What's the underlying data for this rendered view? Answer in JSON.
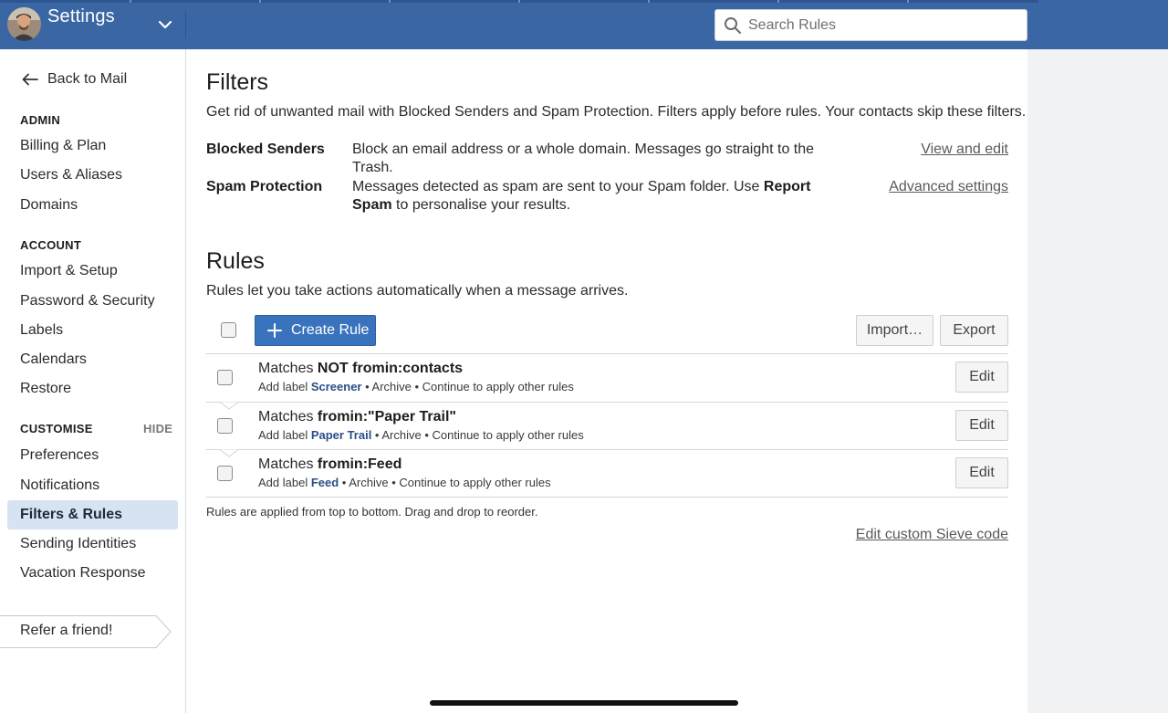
{
  "header": {
    "app_title": "Settings",
    "search": {
      "placeholder": "Search Rules",
      "value": ""
    },
    "brand_color": "#3a66a3"
  },
  "sidebar": {
    "back_label": "Back to Mail",
    "sections": [
      {
        "title": "ADMIN",
        "items": [
          {
            "label": "Billing & Plan"
          },
          {
            "label": "Users & Aliases"
          },
          {
            "label": "Domains"
          }
        ]
      },
      {
        "title": "ACCOUNT",
        "items": [
          {
            "label": "Import & Setup"
          },
          {
            "label": "Password & Security"
          },
          {
            "label": "Labels"
          },
          {
            "label": "Calendars"
          },
          {
            "label": "Restore"
          }
        ]
      },
      {
        "title": "CUSTOMISE",
        "action": "HIDE",
        "items": [
          {
            "label": "Preferences"
          },
          {
            "label": "Notifications"
          },
          {
            "label": "Filters & Rules",
            "active": true
          },
          {
            "label": "Sending Identities"
          },
          {
            "label": "Vacation Response"
          }
        ]
      }
    ],
    "refer_label": "Refer a friend!"
  },
  "filters": {
    "title": "Filters",
    "description": "Get rid of unwanted mail with Blocked Senders and Spam Protection. Filters apply before rules. Your contacts skip these filters.",
    "blocked": {
      "label": "Blocked Senders",
      "description": "Block an email address or a whole domain. Messages go straight to the Trash.",
      "link": "View and edit"
    },
    "spam": {
      "label": "Spam Protection",
      "desc_pre": "Messages detected as spam are sent to your Spam folder. Use ",
      "desc_bold": "Report Spam",
      "desc_post": " to personalise your results.",
      "link": "Advanced settings"
    }
  },
  "rules": {
    "title": "Rules",
    "description": "Rules let you take actions automatically when a message arrives.",
    "create_label": "Create Rule",
    "import_label": "Import…",
    "export_label": "Export",
    "edit_label": "Edit",
    "items": [
      {
        "prefix": "Matches ",
        "condition": "NOT fromin:contacts",
        "add_label_text": "Add label ",
        "tag": "Screener",
        "actions": " • Archive • Continue to apply other rules"
      },
      {
        "prefix": "Matches ",
        "condition": "fromin:\"Paper Trail\"",
        "add_label_text": "Add label ",
        "tag": "Paper Trail",
        "actions": " • Archive • Continue to apply other rules"
      },
      {
        "prefix": "Matches ",
        "condition": "fromin:Feed",
        "add_label_text": "Add label ",
        "tag": "Feed",
        "actions": " • Archive • Continue to apply other rules"
      }
    ],
    "footnote": "Rules are applied from top to bottom. Drag and drop to reorder.",
    "sieve_link": "Edit custom Sieve code"
  }
}
